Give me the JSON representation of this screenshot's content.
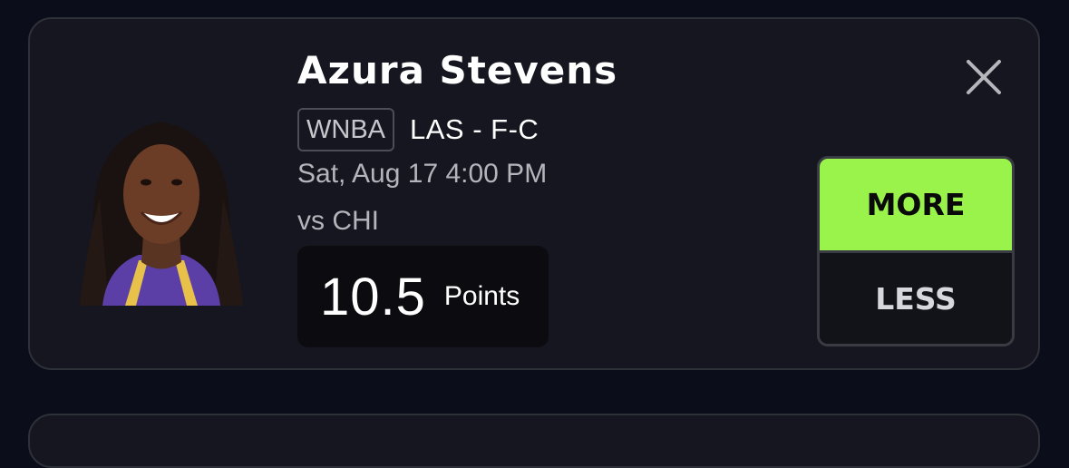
{
  "player": {
    "name": "Azura Stevens",
    "league": "WNBA",
    "team_position": "LAS - F-C",
    "game_time": "Sat, Aug 17 4:00 PM",
    "opponent": "vs CHI",
    "photo_icon": "player-headshot"
  },
  "projection": {
    "value": "10.5",
    "stat": "Points"
  },
  "actions": {
    "more_label": "MORE",
    "less_label": "LESS",
    "close_icon": "close-icon"
  },
  "colors": {
    "background": "#0b0d1a",
    "card": "#15161f",
    "card_border": "#2f3139",
    "more_accent": "#99f34b",
    "stat_box": "#0c0c10"
  }
}
